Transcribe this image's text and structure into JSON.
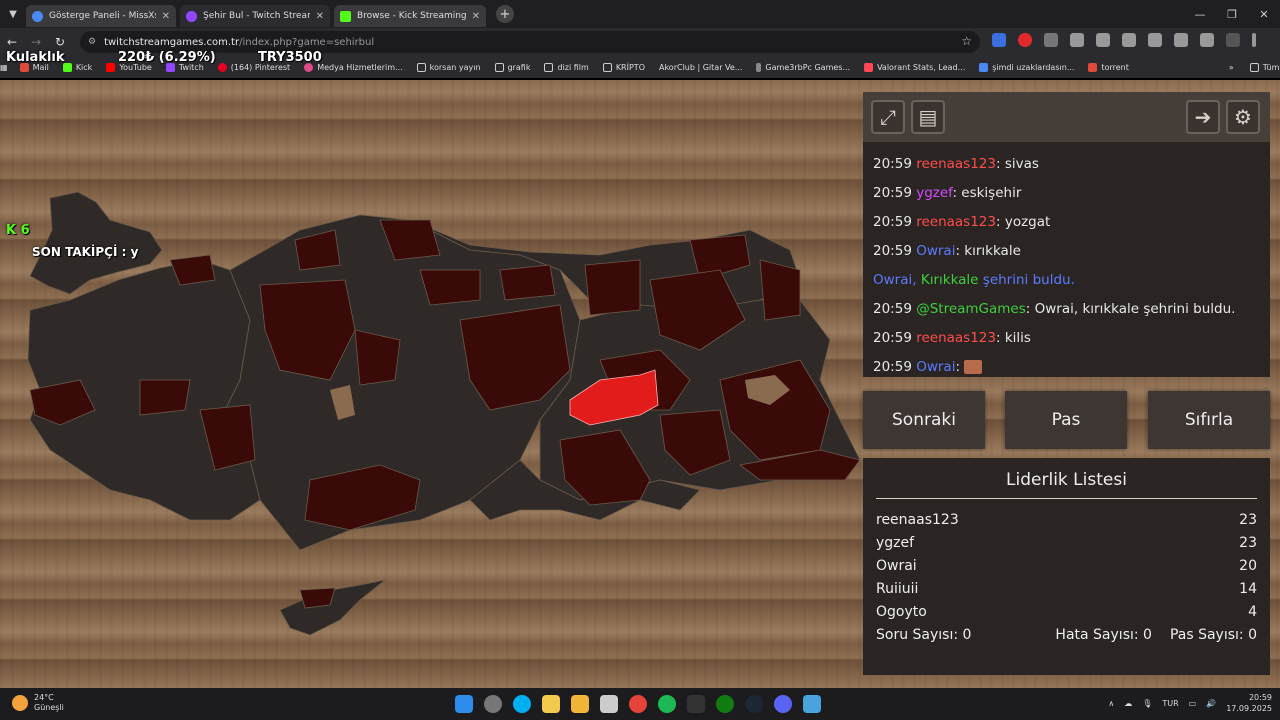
{
  "browser": {
    "tabs": [
      {
        "title": "Gösterge Paneli - MissXss Al Bo",
        "color": "#4a8af4"
      },
      {
        "title": "Şehir Bul - Twitch Stream G",
        "color": "#9146ff"
      },
      {
        "title": "Browse - Kick Streaming",
        "color": "#53fc18"
      }
    ],
    "url_host": "twitchstreamgames.com.tr",
    "url_path": "/index.php?game=sehirbul",
    "bookmarks": [
      {
        "label": "Mail",
        "color": "#e04a3a"
      },
      {
        "label": "Kick",
        "color": "#53fc18"
      },
      {
        "label": "YouTube",
        "color": "#ff0000"
      },
      {
        "label": "Twitch",
        "color": "#9146ff"
      },
      {
        "label": "(164) Pinterest",
        "color": "#e60023"
      },
      {
        "label": "Medya Hizmetlerim...",
        "color": "#e04a8a"
      },
      {
        "label": "korsan yayın",
        "color": "#cccccc"
      },
      {
        "label": "grafik",
        "color": "#cccccc"
      },
      {
        "label": "dizi film",
        "color": "#cccccc"
      },
      {
        "label": "KRİPTO",
        "color": "#cccccc"
      },
      {
        "label": "AkorClub | Gitar Ve...",
        "color": "#2b2b2f"
      },
      {
        "label": "Game3rbPc Games...",
        "color": "#2b2b2f"
      },
      {
        "label": "Valorant Stats, Lead...",
        "color": "#ff4655"
      },
      {
        "label": "şimdi uzaklardasın...",
        "color": "#4a8af4"
      },
      {
        "label": "torrent",
        "color": "#e04a3a"
      }
    ],
    "all_bookmarks": "Tüm Yer İşaretleri"
  },
  "overlay": {
    "name": "Kulaklık",
    "stat1": "220₺ (6.29%)",
    "stat2": "TRY3500",
    "kick_count": "6",
    "last_follower": "SON TAKİPÇİ : y"
  },
  "chat": {
    "messages": [
      {
        "time": "20:59",
        "user": "reenaas123",
        "color": "#ff4d4d",
        "text": ": sivas"
      },
      {
        "time": "20:59",
        "user": "ygzef",
        "color": "#d54bff",
        "text": ": eskişehir"
      },
      {
        "time": "20:59",
        "user": "reenaas123",
        "color": "#ff4d4d",
        "text": ": yozgat"
      },
      {
        "time": "20:59",
        "user": "Owrai",
        "color": "#5b7bff",
        "text": ": kırıkkale"
      },
      {
        "time": "",
        "user": "Owrai,",
        "color": "#5b7bff",
        "text": "Kırıkkale",
        "text2": "şehrini buldu."
      },
      {
        "time": "20:59",
        "user": "@StreamGames",
        "color": "#3ecf3e",
        "text": ": Owrai, kırıkkale şehrini buldu."
      },
      {
        "time": "20:59",
        "user": "reenaas123",
        "color": "#ff4d4d",
        "text": ": kilis"
      },
      {
        "time": "20:59",
        "user": "Owrai",
        "color": "#5b7bff",
        "text": ":"
      }
    ]
  },
  "controls": {
    "next": "Sonraki",
    "pass": "Pas",
    "reset": "Sıfırla"
  },
  "leaderboard": {
    "title": "Liderlik Listesi",
    "rows": [
      {
        "name": "reenaas123",
        "score": "23"
      },
      {
        "name": "ygzef",
        "score": "23"
      },
      {
        "name": "Owrai",
        "score": "20"
      },
      {
        "name": "Ruiiuii",
        "score": "14"
      },
      {
        "name": "Ogoyto",
        "score": "4"
      }
    ],
    "questions": "Soru Sayısı: 0",
    "errors": "Hata Sayısı: 0",
    "passes": "Pas Sayısı: 0"
  },
  "taskbar": {
    "temp": "24°C",
    "weather": "Güneşli",
    "lang": "TUR",
    "time": "20:59",
    "date": "17.09.2025"
  }
}
